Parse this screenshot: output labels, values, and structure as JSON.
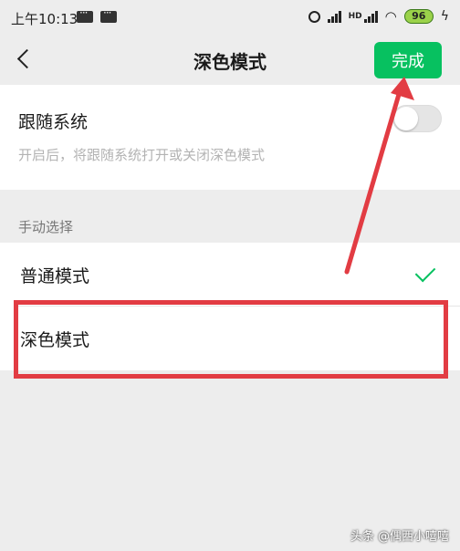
{
  "status_bar": {
    "time": "上午10:13",
    "network_label": "HD",
    "battery": "96"
  },
  "nav": {
    "title": "深色模式",
    "done_label": "完成"
  },
  "follow_system": {
    "title": "跟随系统",
    "description": "开启后，将跟随系统打开或关闭深色模式",
    "enabled": false
  },
  "manual": {
    "section_label": "手动选择",
    "options": [
      {
        "label": "普通模式",
        "selected": true
      },
      {
        "label": "深色模式",
        "selected": false
      }
    ]
  },
  "watermark": "头条 @偶西小嘻嘻",
  "colors": {
    "accent": "#07c160",
    "annotation": "#e23c43",
    "background": "#ededed"
  }
}
